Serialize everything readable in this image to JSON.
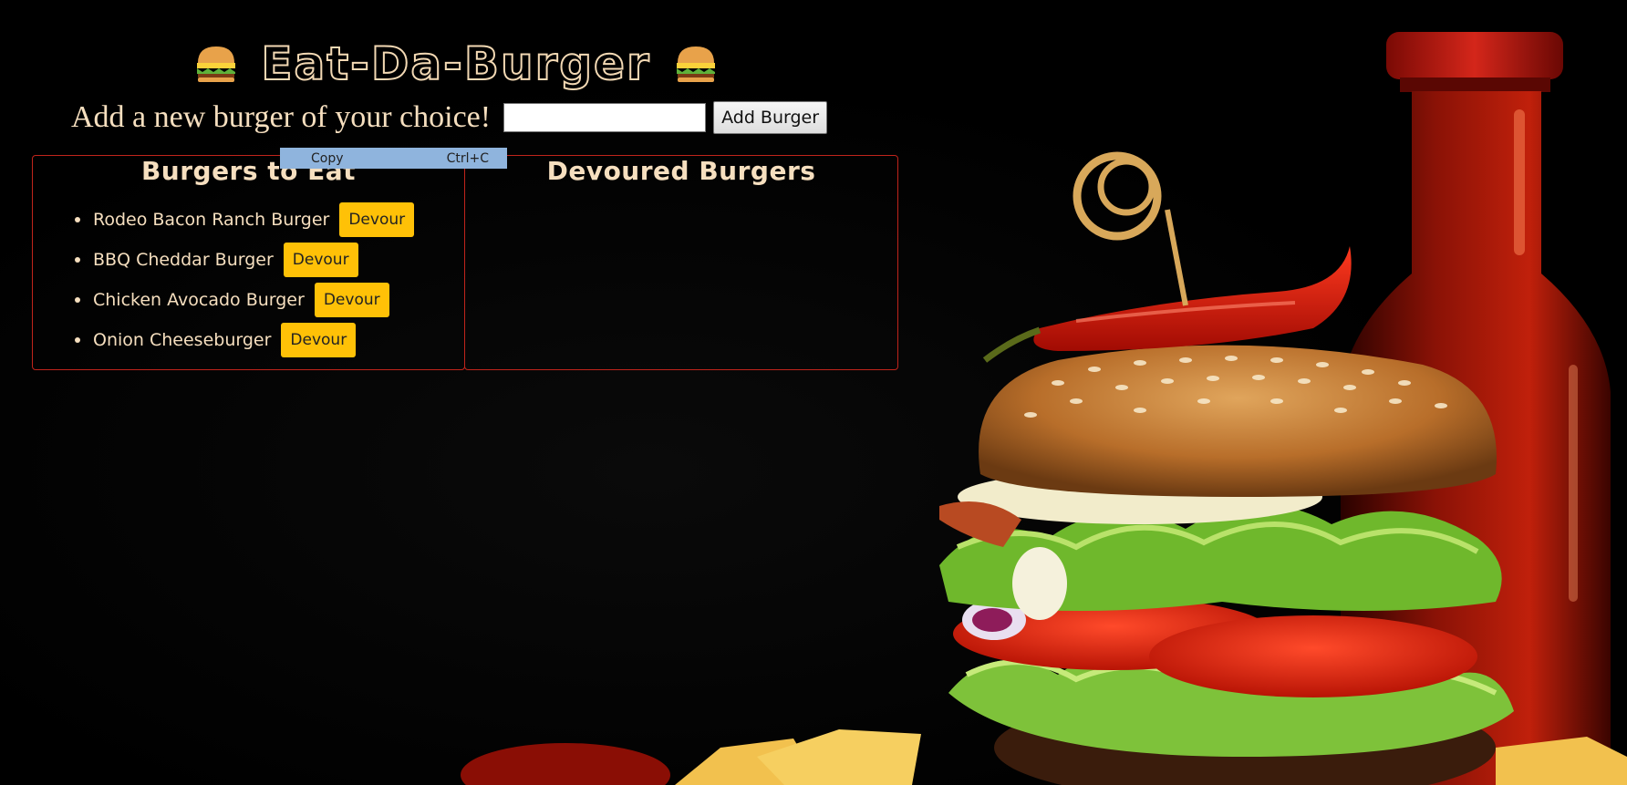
{
  "header": {
    "title": "Eat-Da-Burger",
    "left_icon": "hamburger-icon",
    "right_icon": "hamburger-icon"
  },
  "form": {
    "label": "Add a new burger of your choice!",
    "input_value": "",
    "input_placeholder": "",
    "submit_label": "Add Burger"
  },
  "to_eat": {
    "title": "Burgers to Eat",
    "items": [
      {
        "name": "Rodeo Bacon Ranch Burger",
        "button": "Devour"
      },
      {
        "name": "BBQ Cheddar Burger",
        "button": "Devour"
      },
      {
        "name": "Chicken Avocado Burger",
        "button": "Devour"
      },
      {
        "name": "Onion Cheeseburger",
        "button": "Devour"
      }
    ]
  },
  "devoured": {
    "title": "Devoured Burgers",
    "items": []
  },
  "context_menu": {
    "item_label": "Copy",
    "shortcut": "Ctrl+C"
  },
  "colors": {
    "text_accent": "#f6dfbf",
    "panel_border": "#c0241b",
    "devour_button": "#ffc107",
    "background": "#000000",
    "context_menu_bg": "#8fb4dd"
  }
}
